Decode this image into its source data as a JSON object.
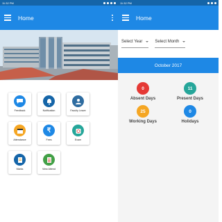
{
  "left": {
    "statusbar": {
      "time": "11:32 PM"
    },
    "appbar": {
      "title": "Home"
    },
    "tiles": [
      {
        "label": "Feedback",
        "icon": "chat-bubble-icon",
        "color": "#1e88e5"
      },
      {
        "label": "Notification",
        "icon": "bell-icon",
        "color": "#1565a8"
      },
      {
        "label": "Faculty Leave",
        "icon": "faculty-leave-icon",
        "color": "#2e6ca0"
      },
      {
        "label": "Attendance",
        "icon": "calendar-icon",
        "color": "#f5a623"
      },
      {
        "label": "Fees",
        "icon": "rupee-icon",
        "color": "#1e88e5"
      },
      {
        "label": "Exam",
        "icon": "exam-clock-icon",
        "color": "#26a69a"
      },
      {
        "label": "Marks",
        "icon": "marks-document-icon",
        "color": "#1565a8"
      },
      {
        "label": "View Attend",
        "icon": "view-attendance-icon",
        "color": "#43a047"
      }
    ]
  },
  "right": {
    "statusbar": {
      "time": "11:32 PM"
    },
    "appbar": {
      "title": "Home"
    },
    "select_year": "Select Year",
    "select_month": "Select Month",
    "month_title": "October 2017",
    "stats": [
      {
        "value": "0",
        "label": "Absent Days",
        "color": "#e53935"
      },
      {
        "value": "11",
        "label": "Present Days",
        "color": "#26a69a"
      },
      {
        "value": "25",
        "label": "Working Days",
        "color": "#f5a623"
      },
      {
        "value": "0",
        "label": "Holidays",
        "color": "#1e88e5"
      }
    ]
  }
}
